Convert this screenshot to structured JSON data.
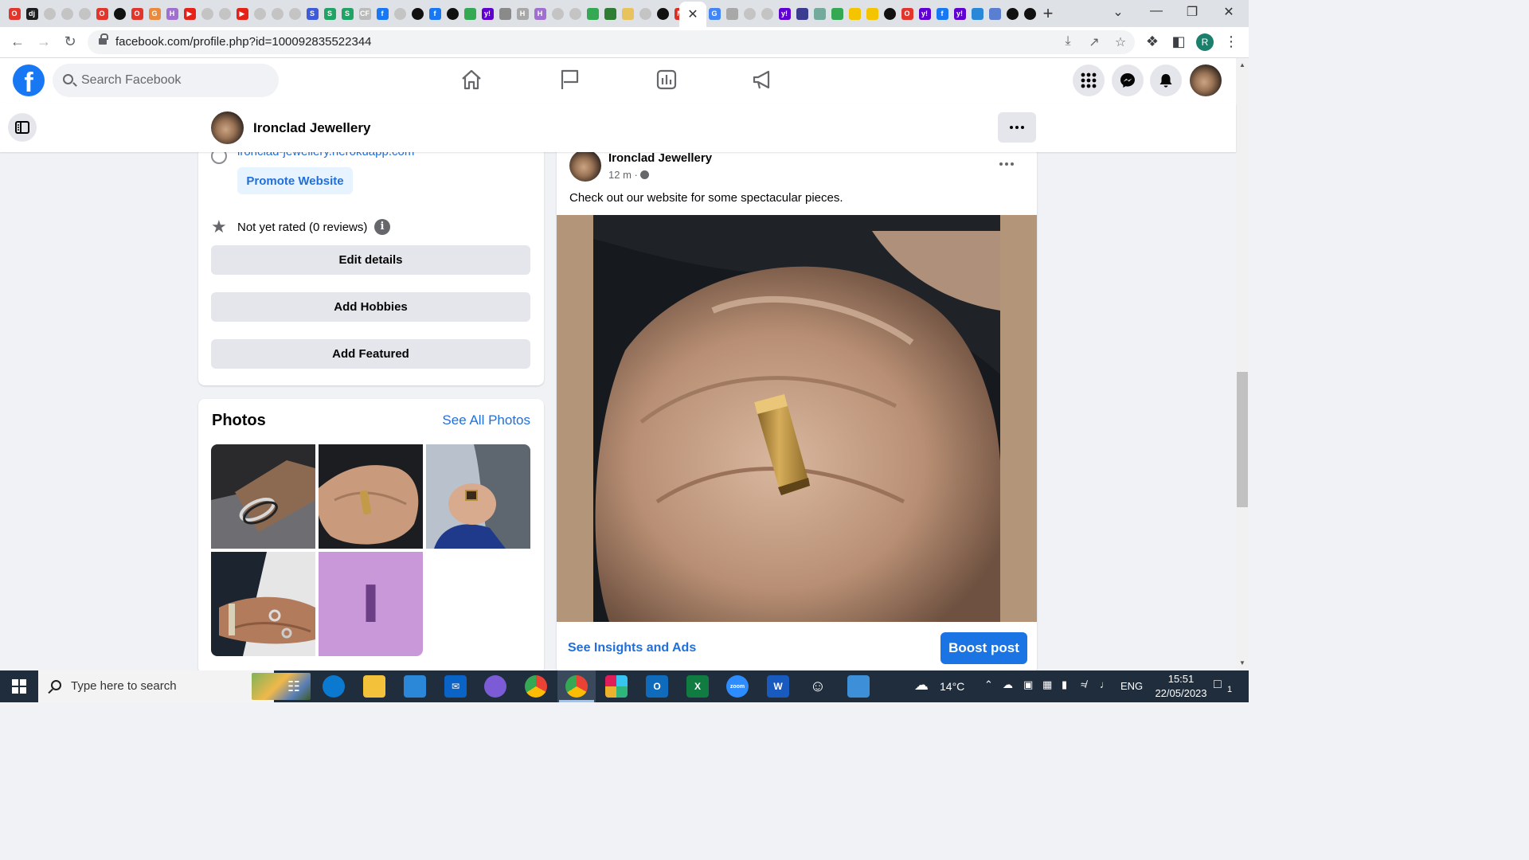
{
  "browser": {
    "url": "facebook.com/profile.php?id=100092835522344",
    "profile_initial": "R",
    "tab_close": "✕",
    "new_tab": "+",
    "tabs": [
      {
        "icon": "opera-icon",
        "color": "#e2362c",
        "glyph": "O"
      },
      {
        "icon": "dj-icon",
        "color": "#1d1d1d",
        "glyph": "dj"
      },
      {
        "icon": "github-icon",
        "color": "#c4c4c4",
        "glyph": ""
      },
      {
        "icon": "github-icon",
        "color": "#c4c4c4",
        "glyph": ""
      },
      {
        "icon": "github-icon",
        "color": "#c4c4c4",
        "glyph": ""
      },
      {
        "icon": "opera-icon",
        "color": "#e2362c",
        "glyph": "O"
      },
      {
        "icon": "github-dark-icon",
        "color": "#111111",
        "glyph": ""
      },
      {
        "icon": "opera-icon",
        "color": "#e2362c",
        "glyph": "O"
      },
      {
        "icon": "google-icon",
        "color": "#ea8a3c",
        "glyph": "G"
      },
      {
        "icon": "hubspot-icon",
        "color": "#a06fcf",
        "glyph": "H"
      },
      {
        "icon": "youtube-icon",
        "color": "#e62117",
        "glyph": "▶"
      },
      {
        "icon": "github-icon",
        "color": "#c4c4c4",
        "glyph": ""
      },
      {
        "icon": "github-icon",
        "color": "#c4c4c4",
        "glyph": ""
      },
      {
        "icon": "youtube-icon",
        "color": "#e62117",
        "glyph": "▶"
      },
      {
        "icon": "github-icon",
        "color": "#c4c4c4",
        "glyph": ""
      },
      {
        "icon": "github-icon",
        "color": "#c4c4c4",
        "glyph": ""
      },
      {
        "icon": "github-icon",
        "color": "#c4c4c4",
        "glyph": ""
      },
      {
        "icon": "s-app-icon",
        "color": "#3f5bd8",
        "glyph": "S"
      },
      {
        "icon": "s-app-icon",
        "color": "#21a366",
        "glyph": "S"
      },
      {
        "icon": "s-app-icon",
        "color": "#21a366",
        "glyph": "S"
      },
      {
        "icon": "cf-icon",
        "color": "#bbbbbb",
        "glyph": "CF"
      },
      {
        "icon": "facebook-icon",
        "color": "#1877f2",
        "glyph": "f"
      },
      {
        "icon": "github-icon",
        "color": "#c4c4c4",
        "glyph": ""
      },
      {
        "icon": "github-dark-icon",
        "color": "#111111",
        "glyph": ""
      },
      {
        "icon": "facebook-icon",
        "color": "#1877f2",
        "glyph": "f"
      },
      {
        "icon": "github-dark-icon",
        "color": "#111111",
        "glyph": ""
      },
      {
        "icon": "sheets-icon",
        "color": "#34a853",
        "glyph": ""
      },
      {
        "icon": "yahoo-icon",
        "color": "#5f01d1",
        "glyph": "y!"
      },
      {
        "icon": "chart-icon",
        "color": "#8a8a8a",
        "glyph": ""
      },
      {
        "icon": "hubspot-icon",
        "color": "#a8a8a8",
        "glyph": "H"
      },
      {
        "icon": "hubspot-icon",
        "color": "#a06fcf",
        "glyph": "H"
      },
      {
        "icon": "github-icon",
        "color": "#c4c4c4",
        "glyph": ""
      },
      {
        "icon": "github-icon",
        "color": "#c4c4c4",
        "glyph": ""
      },
      {
        "icon": "sheets-icon",
        "color": "#34a853",
        "glyph": ""
      },
      {
        "icon": "pin-icon",
        "color": "#2e7d32",
        "glyph": ""
      },
      {
        "icon": "doc-icon",
        "color": "#e8c25c",
        "glyph": ""
      },
      {
        "icon": "github-icon",
        "color": "#c4c4c4",
        "glyph": ""
      },
      {
        "icon": "github-dark-icon",
        "color": "#111111",
        "glyph": ""
      },
      {
        "icon": "gmail-icon",
        "color": "#d93025",
        "glyph": "M"
      }
    ],
    "tabs_after": [
      {
        "icon": "google-icon",
        "color": "#4285f4",
        "glyph": "G"
      },
      {
        "icon": "pin-icon",
        "color": "#a8a8a8",
        "glyph": ""
      },
      {
        "icon": "github-icon",
        "color": "#c4c4c4",
        "glyph": ""
      },
      {
        "icon": "github-icon",
        "color": "#c4c4c4",
        "glyph": ""
      },
      {
        "icon": "yahoo-icon",
        "color": "#5f01d1",
        "glyph": "y!"
      },
      {
        "icon": "app-icon",
        "color": "#3b3b8f",
        "glyph": ""
      },
      {
        "icon": "chatgpt-icon",
        "color": "#74aa9c",
        "glyph": ""
      },
      {
        "icon": "sheets-icon",
        "color": "#34a853",
        "glyph": ""
      },
      {
        "icon": "pacman-icon",
        "color": "#f5c400",
        "glyph": ""
      },
      {
        "icon": "pacman-icon",
        "color": "#f5c400",
        "glyph": ""
      },
      {
        "icon": "github-dark-icon",
        "color": "#111111",
        "glyph": ""
      },
      {
        "icon": "opera-icon",
        "color": "#e2362c",
        "glyph": "O"
      },
      {
        "icon": "yahoo-icon",
        "color": "#5f01d1",
        "glyph": "y!"
      },
      {
        "icon": "facebook-icon",
        "color": "#1877f2",
        "glyph": "f"
      },
      {
        "icon": "yahoo-icon",
        "color": "#5f01d1",
        "glyph": "y!"
      },
      {
        "icon": "edge-icon",
        "color": "#2b88d8",
        "glyph": ""
      },
      {
        "icon": "app-icon",
        "color": "#5a7fd0",
        "glyph": ""
      },
      {
        "icon": "github-dark-icon",
        "color": "#111111",
        "glyph": ""
      },
      {
        "icon": "github-dark-icon",
        "color": "#111111",
        "glyph": ""
      }
    ]
  },
  "facebook": {
    "search_placeholder": "Search Facebook",
    "nav": [
      "home-icon",
      "flag-icon",
      "insights-icon",
      "ads-megaphone-icon"
    ],
    "brand_color": "#1877f2"
  },
  "page_header": {
    "name": "Ironclad Jewellery"
  },
  "intro": {
    "website": "ironclad-jewellery.herokuapp.com",
    "promote_label": "Promote Website",
    "rating": "Not yet rated (0 reviews)",
    "info_glyph": "i",
    "edit_details": "Edit details",
    "add_hobbies": "Add Hobbies",
    "add_featured": "Add Featured"
  },
  "photos": {
    "title": "Photos",
    "see_all": "See All Photos",
    "placeholder_letter": "I"
  },
  "post": {
    "author": "Ironclad Jewellery",
    "time": "12 m ·",
    "text": "Check out our website for some spectacular pieces.",
    "insights_label": "See Insights and Ads",
    "boost_label": "Boost post"
  },
  "taskbar": {
    "search_text": "Type here to search",
    "weather": "14°C",
    "language": "ENG",
    "time": "15:51",
    "date": "22/05/2023",
    "notifications": "1"
  }
}
